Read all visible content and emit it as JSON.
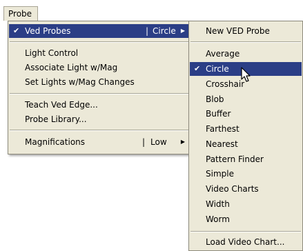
{
  "menubar": {
    "probe_label": "Probe"
  },
  "main_menu": {
    "ved_probes": {
      "check": "✔",
      "label": "Ved Probes",
      "separator": "|",
      "value": "Circle",
      "arrow": "▶"
    },
    "light_control": "Light Control",
    "associate_light": "Associate Light w/Mag",
    "set_lights": "Set Lights w/Mag Changes",
    "teach_ved_edge": "Teach Ved Edge...",
    "probe_library": "Probe Library...",
    "magnifications": {
      "label": "Magnifications",
      "separator": "|",
      "value": "Low",
      "arrow": "▶"
    }
  },
  "sub_menu": {
    "new_ved_probe": "New VED Probe",
    "average": "Average",
    "circle": {
      "check": "✔",
      "label": "Circle"
    },
    "crosshair": "Crosshair",
    "blob": "Blob",
    "buffer": "Buffer",
    "farthest": "Farthest",
    "nearest": "Nearest",
    "pattern_finder": "Pattern Finder",
    "simple": "Simple",
    "video_charts": "Video Charts",
    "width": "Width",
    "worm": "Worm",
    "load_video_chart": "Load Video Chart..."
  },
  "colors": {
    "menu_bg": "#ece9d8",
    "highlight_bg": "#2b3e86",
    "highlight_text": "#ffffff"
  },
  "icons": {
    "check": "check-icon",
    "submenu_arrow": "submenu-arrow-icon",
    "cursor": "mouse-pointer-icon"
  }
}
